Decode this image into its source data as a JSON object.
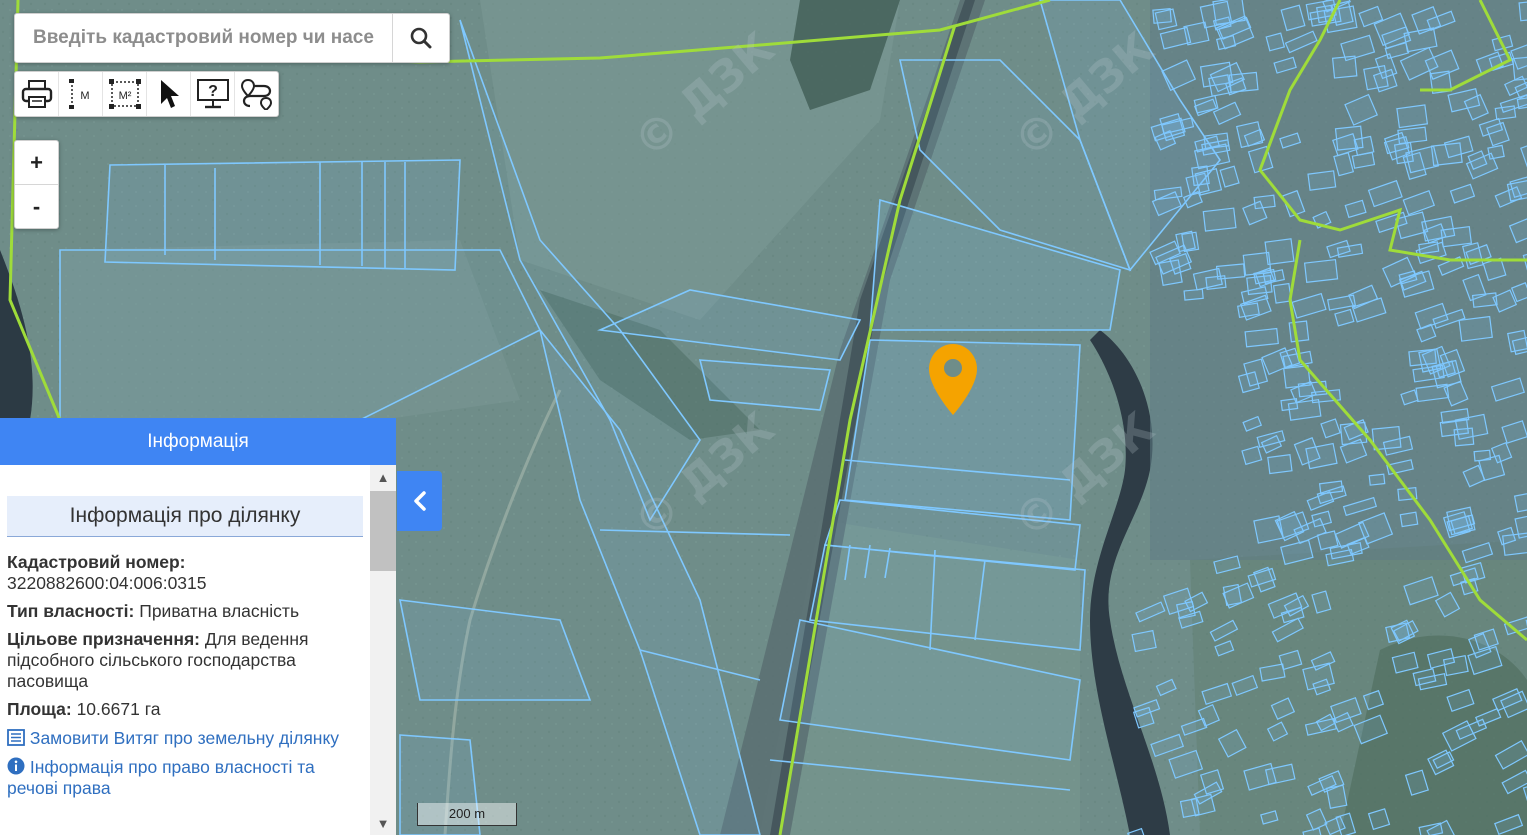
{
  "search": {
    "placeholder": "Введіть кадастровий номер чи населе"
  },
  "toolbar": {
    "tools": [
      {
        "icon": "print-icon"
      },
      {
        "icon": "measure-length-icon",
        "label": "M"
      },
      {
        "icon": "measure-area-icon",
        "label": "M²"
      },
      {
        "icon": "select-pointer-icon"
      },
      {
        "icon": "info-query-icon",
        "label": "?"
      },
      {
        "icon": "route-icon"
      }
    ]
  },
  "zoom": {
    "in_label": "+",
    "out_label": "-"
  },
  "info_panel": {
    "header": "Інформація",
    "title": "Інформація про ділянку",
    "cadastral_label": "Кадастровий номер:",
    "cadastral_value": "3220882600:04:006:0315",
    "ownership_label": "Тип власності:",
    "ownership_value": "Приватна власність",
    "purpose_label": "Цільове призначення:",
    "purpose_value": "Для ведення підсобного сільського господарства пасовища",
    "area_label": "Площа:",
    "area_value": "10.6671 га",
    "link_extract": "Замовити Витяг про земельну ділянку",
    "link_rights": "Інформація про право власності та речові права"
  },
  "scale": {
    "label": "200 m"
  },
  "colors": {
    "accent_blue": "#3f85f3",
    "parcel_outline": "#7fc8ff",
    "boundary_green": "#9fdc3a",
    "marker_orange": "#f5a300"
  }
}
